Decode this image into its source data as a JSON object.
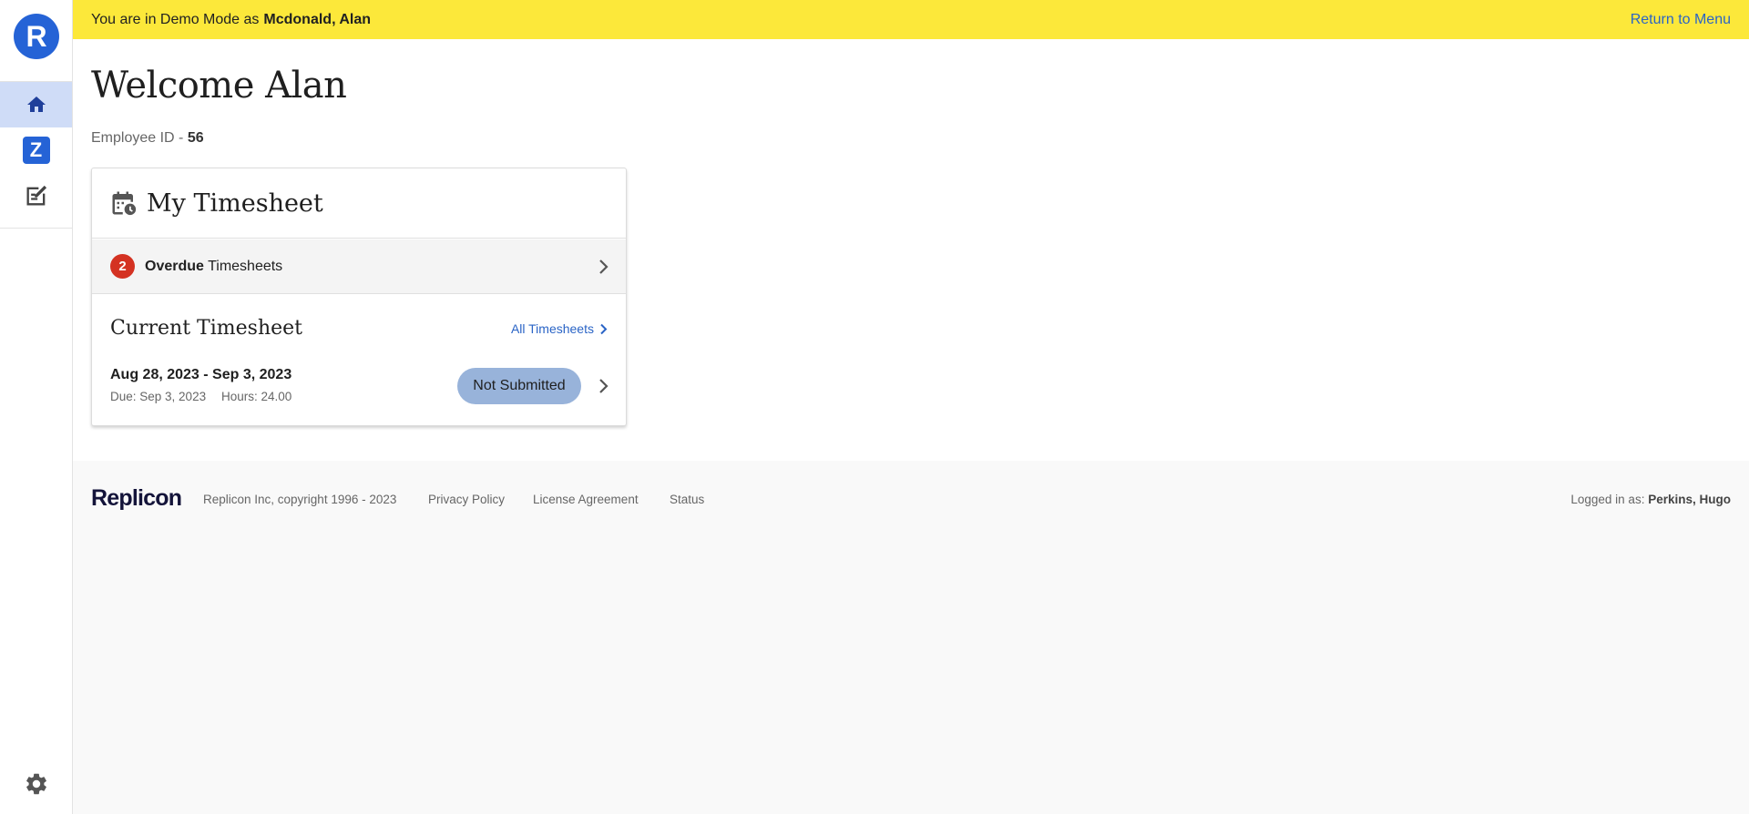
{
  "app": {
    "logo_letter": "R"
  },
  "sidebar": {
    "items": [
      {
        "icon": "home-icon",
        "active": true
      },
      {
        "icon": "z-app-icon",
        "label": "Z"
      },
      {
        "icon": "edit-note-icon"
      }
    ],
    "settings_icon": "gear-icon"
  },
  "banner": {
    "prefix": "You are in Demo Mode as",
    "user": "Mcdonald, Alan",
    "return_label": "Return to Menu",
    "color": "#fce83a"
  },
  "main": {
    "welcome": "Welcome Alan",
    "employee_id_label": "Employee ID -",
    "employee_id": "56"
  },
  "timesheet_card": {
    "title": "My Timesheet",
    "overdue_count": "2",
    "overdue_bold": "Overdue",
    "overdue_text": "Timesheets",
    "current_title": "Current Timesheet",
    "all_link": "All Timesheets",
    "period": "Aug 28, 2023 - Sep 3, 2023",
    "due": "Due: Sep 3, 2023",
    "hours": "Hours: 24.00",
    "status": "Not Submitted"
  },
  "footer": {
    "brand": "Replicon",
    "copyright": "Replicon Inc, copyright 1996 - 2023",
    "privacy": "Privacy Policy",
    "license": "License Agreement",
    "status": "Status",
    "logged_label": "Logged in as:",
    "logged_user": "Perkins, Hugo"
  }
}
